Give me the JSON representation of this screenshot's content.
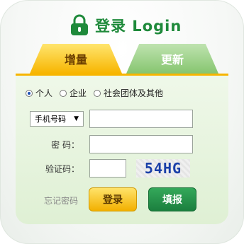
{
  "header": {
    "title": "登录 Login"
  },
  "tabs": [
    {
      "label": "增量"
    },
    {
      "label": "更新"
    }
  ],
  "user_type": {
    "options": [
      "个人",
      "企业",
      "社会团体及其他"
    ],
    "selected": "个人"
  },
  "form": {
    "account_type_selected": "手机号码",
    "password_label": "密  码：",
    "captcha_label": "验证码：",
    "captcha_text": "54HG"
  },
  "actions": {
    "forgot_password": "忘记密码",
    "login": "登录",
    "register": "填报"
  },
  "colors": {
    "brand_green": "#1f8a3b",
    "accent_yellow": "#f7b500"
  }
}
